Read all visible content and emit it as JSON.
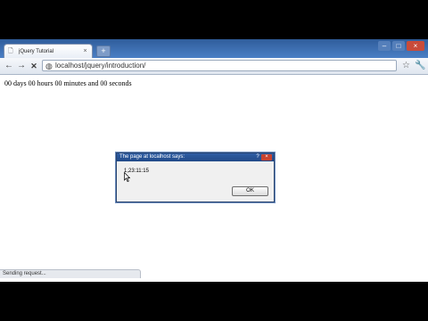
{
  "browser": {
    "tab_title": "jQuery Tutorial",
    "tab_close": "×",
    "new_tab": "+",
    "url": "localhost/jquery/introduction/"
  },
  "window_controls": {
    "minimize": "–",
    "maximize": "□",
    "close": "×"
  },
  "toolbar": {
    "back": "←",
    "forward": "→",
    "stop": "✕"
  },
  "page": {
    "countdown_text": "00 days 00 hours 00 minutes and 00 seconds"
  },
  "dialog": {
    "title": "The page at localhost says:",
    "help": "?",
    "close": "×",
    "message": "1,23:11:15",
    "ok_label": "OK"
  },
  "status": {
    "text": "Sending request..."
  },
  "icons": {
    "tab_favicon": "page-icon",
    "page_icon": "globe-icon",
    "bookmark": "star-icon",
    "menu": "wrench-icon"
  },
  "colors": {
    "tabstrip": "#3f6eae",
    "dialog_titlebar": "#2a539a",
    "close_red": "#c94b3a"
  }
}
